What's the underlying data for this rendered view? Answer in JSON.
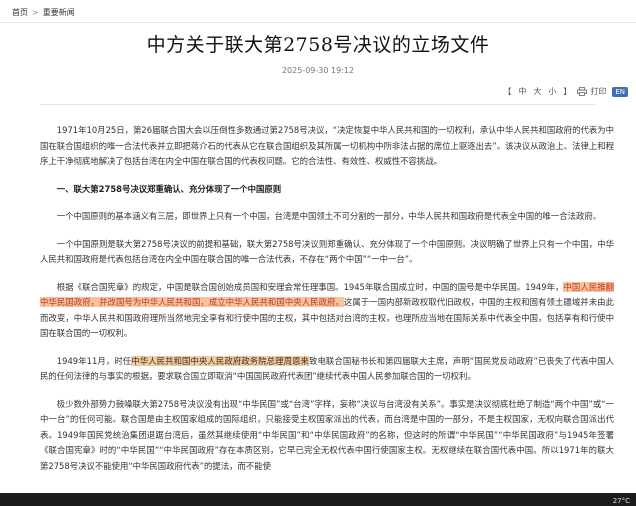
{
  "breadcrumb": {
    "home": "首页",
    "separator": ">",
    "section": "重要新闻"
  },
  "article": {
    "title": "中方关于联大第2758号决议的立场文件",
    "date": "2025-09-30 19:12"
  },
  "toolbar": {
    "font_open": "【",
    "font_large": "中",
    "font_medium": "大",
    "font_small": "小",
    "font_close": "】",
    "print_label": "打印",
    "lang_badge": "EN"
  },
  "paragraphs": {
    "p1": "1971年10月25日，第26届联合国大会以压倒性多数通过第2758号决议，“决定恢复中华人民共和国的一切权利，承认中华人民共和国政府的代表为中国在联合国组织的唯一合法代表并立即把蒋介石的代表从它在联合国组织及其所属一切机构中所非法占据的席位上驱逐出去”。该决议从政治上、法律上和程序上干净彻底地解决了包括台湾在内全中国在联合国的代表权问题。它的合法性、有效性、权威性不容挑战。",
    "h1": "一、联大第2758号决议郑重确认、充分体现了一个中国原则",
    "p2": "一个中国原则的基本涵义有三层，即世界上只有一个中国，台湾是中国领土不可分割的一部分，中华人民共和国政府是代表全中国的唯一合法政府。",
    "p3": "一个中国原则是联大第2758号决议的前提和基础，联大第2758号决议则郑重确认、充分体现了一个中国原则。决议明确了世界上只有一个中国，中华人民共和国政府是代表包括台湾在内全中国在联合国的唯一合法代表，不存在“两个中国”“一中一台”。",
    "p4_a": "根据《联合国宪章》的规定，中国是联合国创始成员国和安理会常任理事国。1945年联合国成立时，中国的国号是中华民国。1949年，",
    "p4_hl": "中国人民推翻中华民国政府，并改国号为中华人民共和国，成立中华人民共和国中央人民政府。",
    "p4_b": "这属于一国内部新政权取代旧政权，中国的主权和固有领土疆域并未由此而改变，中华人民共和国政府理所当然地完全享有和行使中国的主权，其中包括对台湾的主权，也理所应当地在国际关系中代表全中国，包括享有和行使中国在联合国的一切权利。",
    "p5_a": "1949年11月，时任",
    "p5_hl": "中华人民共和国中央人民政府政务院总理周恩来",
    "p5_b": "致电联合国秘书长和第四届联大主席，声明“国民党反动政府”已丧失了代表中国人民的任何法律的与事实的根据，要求联合国立即取消“中国国民政府代表团”继续代表中国人民参加联合国的一切权利。",
    "p6": "极少数外部势力鼓噪联大第2758号决议没有出现“中华民国”或“台湾”字样，妄称“决议与台湾没有关系”。事实是决议彻底杜绝了制造“两个中国”或“一中一台”的任何可能。联合国是由主权国家组成的国际组织，只能接受主权国家派出的代表，而台湾是中国的一部分，不是主权国家，无权向联合国派出代表。1949年国民党统治集团退踞台湾后，虽然其继续使用“中华民国”和“中华民国政府”的名称，但这时的所谓“中华民国”“中华民国政府”与1945年签署《联合国宪章》时的“中华民国”“中华民国政府”存在本质区别，它早已完全无权代表中国行使国家主权。无权继续在联合国代表中国。所以1971年的联大第2758号决议不能使用“中华民国政府代表”的提法，而不能使"
  },
  "taskbar": {
    "temperature": "27°C"
  },
  "colors": {
    "highlight": "#f4cc9b",
    "lang_badge": "#3f6fb5",
    "taskbar": "#1c1c1c"
  }
}
